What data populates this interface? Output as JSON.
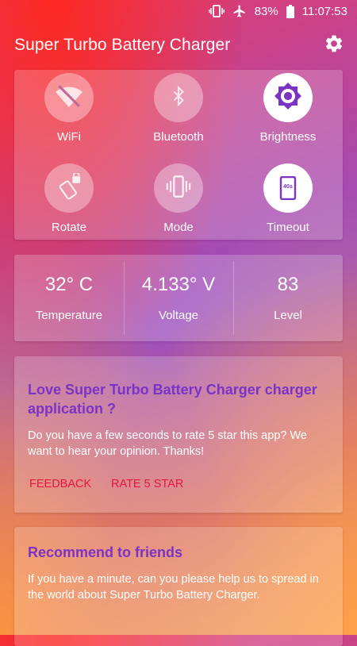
{
  "status_bar": {
    "battery_percent": "83%",
    "time": "11:07:53"
  },
  "app_bar": {
    "title": "Super Turbo Battery Charger"
  },
  "toggles": [
    {
      "label": "WiFi",
      "icon": "wifi-off-icon",
      "active": false
    },
    {
      "label": "Bluetooth",
      "icon": "bluetooth-icon",
      "active": false
    },
    {
      "label": "Brightness",
      "icon": "brightness-icon",
      "active": true
    },
    {
      "label": "Rotate",
      "icon": "rotate-lock-icon",
      "active": false
    },
    {
      "label": "Mode",
      "icon": "vibrate-icon",
      "active": false
    },
    {
      "label": "Timeout",
      "icon": "timeout-icon",
      "active": true,
      "badge": "40s"
    }
  ],
  "stats": [
    {
      "value": "32° C",
      "label": "Temperature"
    },
    {
      "value": "4.133° V",
      "label": "Voltage"
    },
    {
      "value": "83",
      "label": "Level"
    }
  ],
  "rate_card": {
    "title": "Love Super Turbo Battery Charger charger application ?",
    "body": "Do you have a few seconds to rate 5 star this app? We want to hear your opinion. Thanks!",
    "feedback_label": "FEEDBACK",
    "rate_label": "RATE 5 STAR"
  },
  "recommend_card": {
    "title": "Recommend to friends",
    "body": "If you have a minute, can you please help us to spread in the world about Super Turbo Battery Charger."
  },
  "colors": {
    "accent": "#7b33c6",
    "link": "#e8133f"
  }
}
